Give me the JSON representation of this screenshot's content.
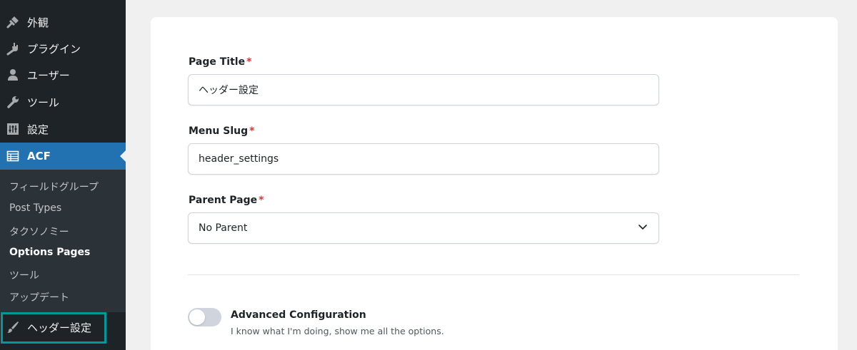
{
  "sidebar": {
    "menu": [
      {
        "label": "外観",
        "icon": "paintbrush-pin-icon"
      },
      {
        "label": "プラグイン",
        "icon": "plug-icon"
      },
      {
        "label": "ユーザー",
        "icon": "user-icon"
      },
      {
        "label": "ツール",
        "icon": "wrench-icon"
      },
      {
        "label": "設定",
        "icon": "settings-sliders-icon"
      },
      {
        "label": "ACF",
        "icon": "acf-grid-icon"
      }
    ],
    "submenu": [
      "フィールドグループ",
      "Post Types",
      "タクソノミー",
      "Options Pages",
      "ツール",
      "アップデート"
    ],
    "active_submenu": "Options Pages",
    "highlighted_item": {
      "label": "ヘッダー設定",
      "icon": "brush-icon"
    },
    "colors": {
      "bg": "#1d2327",
      "submenu_bg": "#2c3338",
      "current": "#2271b1",
      "highlight_border": "#00999b"
    }
  },
  "form": {
    "page_title": {
      "label": "Page Title",
      "required": "*",
      "value": "ヘッダー設定"
    },
    "menu_slug": {
      "label": "Menu Slug",
      "required": "*",
      "value": "header_settings"
    },
    "parent_page": {
      "label": "Parent Page",
      "required": "*",
      "value": "No Parent"
    },
    "advanced": {
      "title": "Advanced Configuration",
      "description": "I know what I'm doing, show me all the options.",
      "enabled": false
    }
  }
}
